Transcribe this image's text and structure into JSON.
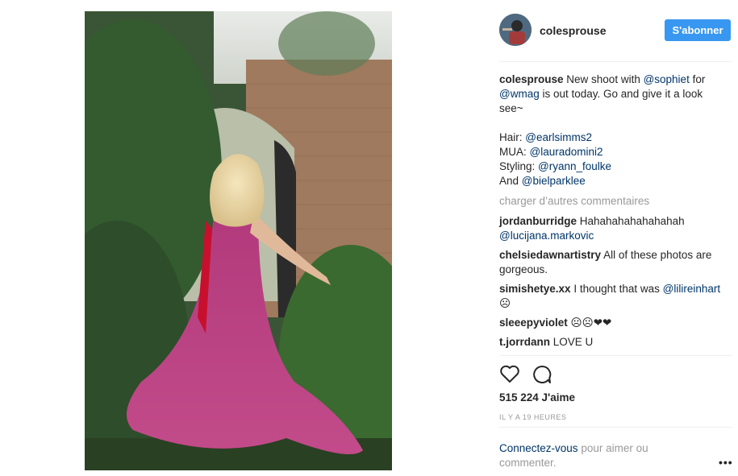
{
  "post": {
    "author": "colesprouse",
    "follow_label": "S'abonner",
    "caption": {
      "author": "colesprouse",
      "text_1": " New shoot with ",
      "mention_1": "@sophiet",
      "text_2": " for ",
      "mention_2": "@wmag",
      "text_3": " is out today. Go and give it a look see~",
      "credits": [
        {
          "label": "Hair: ",
          "mention": "@earlsimms2"
        },
        {
          "label": "MUA: ",
          "mention": "@lauradomini2"
        },
        {
          "label": "Styling: ",
          "mention": "@ryann_foulke"
        },
        {
          "label": "And ",
          "mention": "@bielparklee"
        }
      ]
    },
    "load_more_label": "charger d’autres commentaires",
    "comments": [
      {
        "user": "jordanburridge",
        "text": " Hahahahahahahahah ",
        "mention": "@lucijana.markovic",
        "after": ""
      },
      {
        "user": "chelsiedawnartistry",
        "text": " All of these photos are gorgeous.",
        "mention": "",
        "after": ""
      },
      {
        "user": "simishetye.xx",
        "text": " I thought that was ",
        "mention": "@lilireinhart",
        "after": " ☹"
      },
      {
        "user": "sleeepyviolet",
        "text": " ☹☹❤❤",
        "mention": "",
        "after": ""
      },
      {
        "user": "t.jorrdann",
        "text": " LOVE U",
        "mention": "",
        "after": ""
      }
    ],
    "likes": "515 224 J'aime",
    "timestamp": "IL Y A 19 HEURES",
    "login_link": "Connectez-vous",
    "login_text": " pour aimer ou commenter.",
    "more_options": "•••"
  },
  "icons": {
    "like": "heart-outline-icon",
    "comment": "speech-bubble-icon"
  }
}
